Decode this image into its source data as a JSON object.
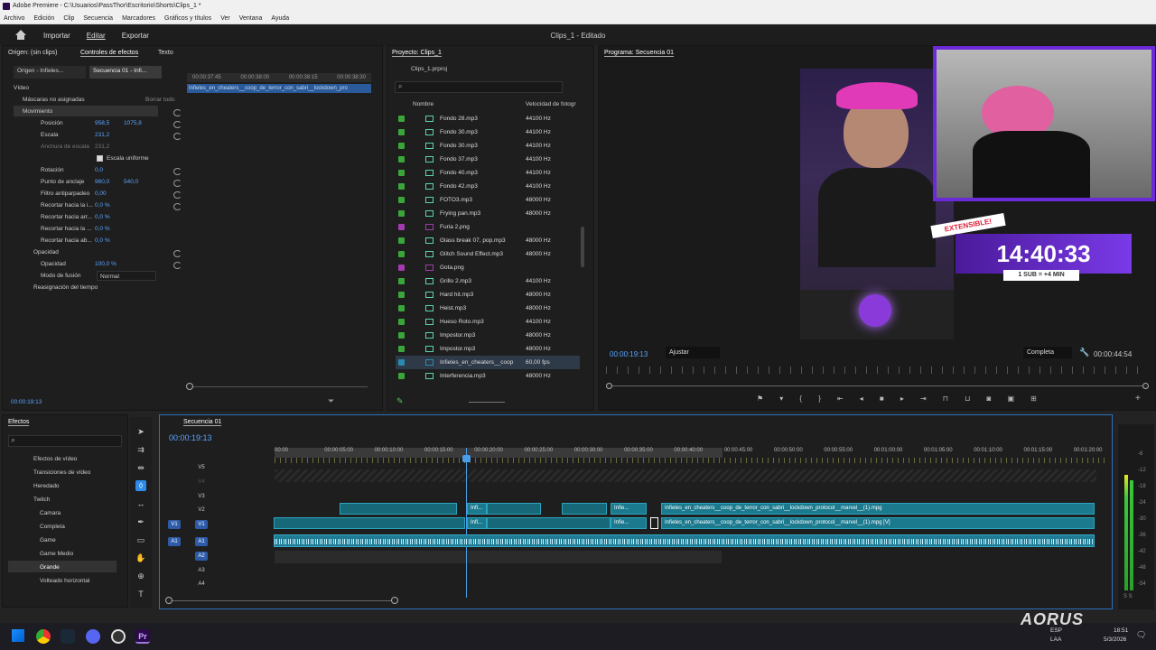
{
  "window": {
    "title": "Adobe Premiere - C:\\Usuarios\\PassThor\\Escritorio\\Shorts\\Clips_1 *"
  },
  "menu": [
    "Archivo",
    "Edición",
    "Clip",
    "Secuencia",
    "Marcadores",
    "Gráficos y títulos",
    "Ver",
    "Ventana",
    "Ayuda"
  ],
  "workspace": {
    "tabs": [
      "Importar",
      "Editar",
      "Exportar"
    ],
    "active": "Editar",
    "project_title": "Clips_1 - Editado"
  },
  "effect_controls": {
    "tabs": [
      "Origen: (sin clips)",
      "Controles de efectos",
      "Texto"
    ],
    "sub_tabs": [
      "Origen - Infieles...",
      "Secuencia 01 - Infi..."
    ],
    "ruler_times": [
      "00:00:37:45",
      "00:00:38:00",
      "00:00:38:15",
      "00:00:38:30"
    ],
    "clip_name": "Infieles_en_cheaters__coop_de_terror_con_sabri__lockdown_pro",
    "section_video": "Vídeo",
    "masks": "Máscaras no asignadas",
    "delete_all": "Borrar todo",
    "rows": [
      {
        "label": "Movimiento",
        "values": []
      },
      {
        "label": "Posición",
        "values": [
          "958,5",
          "1075,8"
        ]
      },
      {
        "label": "Escala",
        "values": [
          "231,2"
        ]
      },
      {
        "label": "Anchura de escala",
        "values": [
          "231,2"
        ]
      },
      {
        "label": "Escala uniforme",
        "values": []
      },
      {
        "label": "Rotación",
        "values": [
          "0,0"
        ]
      },
      {
        "label": "Punto de anclaje",
        "values": [
          "960,0",
          "540,0"
        ]
      },
      {
        "label": "Filtro antiparpadeo",
        "values": [
          "0,00"
        ]
      },
      {
        "label": "Recortar hacia la i...",
        "values": [
          "0,0 %"
        ]
      },
      {
        "label": "Recortar hacia arr...",
        "values": [
          "0,0 %"
        ]
      },
      {
        "label": "Recortar hacia la ...",
        "values": [
          "0,0 %"
        ]
      },
      {
        "label": "Recortar hacia ab...",
        "values": [
          "0,0 %"
        ]
      },
      {
        "label": "Opacidad",
        "values": []
      },
      {
        "label": "Opacidad",
        "values": [
          "100,0 %"
        ]
      },
      {
        "label": "Modo de fusión",
        "values": [
          "Normal"
        ]
      },
      {
        "label": "Reasignación del tiempo",
        "values": []
      }
    ],
    "timecode": "00:00:19:13"
  },
  "project": {
    "tab": "Proyecto: Clips_1",
    "file": "Clips_1.prproj",
    "col_name": "Nombre",
    "col_rate": "Velocidad de fotogr",
    "files": [
      {
        "name": "Fondo 28.mp3",
        "rate": "44100 Hz",
        "color": "#3aa63a",
        "type": "audio"
      },
      {
        "name": "Fondo 30.mp3",
        "rate": "44100 Hz",
        "color": "#3aa63a",
        "type": "audio"
      },
      {
        "name": "Fondo 30.mp3",
        "rate": "44100 Hz",
        "color": "#3aa63a",
        "type": "audio"
      },
      {
        "name": "Fondo 37.mp3",
        "rate": "44100 Hz",
        "color": "#3aa63a",
        "type": "audio"
      },
      {
        "name": "Fondo 40.mp3",
        "rate": "44100 Hz",
        "color": "#3aa63a",
        "type": "audio"
      },
      {
        "name": "Fondo 42.mp3",
        "rate": "44100 Hz",
        "color": "#3aa63a",
        "type": "audio"
      },
      {
        "name": "FOTO3.mp3",
        "rate": "48000 Hz",
        "color": "#3aa63a",
        "type": "audio"
      },
      {
        "name": "Frying pan.mp3",
        "rate": "48000 Hz",
        "color": "#3aa63a",
        "type": "audio"
      },
      {
        "name": "Furia 2.png",
        "rate": "",
        "color": "#a23ab0",
        "type": "image"
      },
      {
        "name": "Glass break 07, pop.mp3",
        "rate": "48000 Hz",
        "color": "#3aa63a",
        "type": "audio"
      },
      {
        "name": "Glitch Sound Effect.mp3",
        "rate": "48000 Hz",
        "color": "#3aa63a",
        "type": "audio"
      },
      {
        "name": "Gota.png",
        "rate": "",
        "color": "#a23ab0",
        "type": "image"
      },
      {
        "name": "Grillo 2.mp3",
        "rate": "44100 Hz",
        "color": "#3aa63a",
        "type": "audio"
      },
      {
        "name": "Hard hit.mp3",
        "rate": "48000 Hz",
        "color": "#3aa63a",
        "type": "audio"
      },
      {
        "name": "Heist.mp3",
        "rate": "48000 Hz",
        "color": "#3aa63a",
        "type": "audio"
      },
      {
        "name": "Hueso Roto.mp3",
        "rate": "44100 Hz",
        "color": "#3aa63a",
        "type": "audio"
      },
      {
        "name": "Impostor.mp3",
        "rate": "48000 Hz",
        "color": "#3aa63a",
        "type": "audio"
      },
      {
        "name": "Impostor.mp3",
        "rate": "48000 Hz",
        "color": "#3aa63a",
        "type": "audio"
      },
      {
        "name": "Infieles_en_cheaters__coop",
        "rate": "60,00 fps",
        "color": "#2a8ab0",
        "type": "video"
      },
      {
        "name": "Interferencia.mp3",
        "rate": "48000 Hz",
        "color": "#3aa63a",
        "type": "audio"
      }
    ]
  },
  "program": {
    "tab": "Programa: Secuencia 01",
    "timecode": "00:00:19:13",
    "fit": "Ajustar",
    "quality": "Completa",
    "duration": "00:00:44:54",
    "overlay": {
      "badge": "EXTENSIBLE!",
      "timer": "14:40:33",
      "sub": "1 SUB = +4 MIN"
    }
  },
  "effects": {
    "tab": "Efectos",
    "items": [
      "Efectos de vídeo",
      "Transiciones de vídeo",
      "Heredado",
      "Twitch",
      "Camara",
      "Completa",
      "Game",
      "Game Medio",
      "Grande",
      "Volteado horizontal"
    ]
  },
  "timeline": {
    "tab": "Secuencia 01",
    "timecode": "00:00:19:13",
    "ticks": [
      "00:00",
      "00:00:05:00",
      "00:00:10:00",
      "00:00:15:00",
      "00:00:20:00",
      "00:00:25:00",
      "00:00:30:00",
      "00:00:35:00",
      "00:00:40:00",
      "00:00:45:00",
      "00:00:50:00",
      "00:00:55:00",
      "00:01:00:00",
      "00:01:05:00",
      "00:01:10:00",
      "00:01:15:00",
      "00:01:20:00"
    ],
    "video_tracks": [
      "V5",
      "V4",
      "V3",
      "V2",
      "V1"
    ],
    "audio_tracks": [
      "A1",
      "A2",
      "A3",
      "A4"
    ],
    "clip_v2": "Infieles_en_cheaters__coop_de_terror_con_sabri__lockdown_protocol__marvel__(1).mpg",
    "clip_v1": "Infieles_en_cheaters__coop_de_terror_con_sabri__lockdown_protocol__marvel__(1).mpg [V]",
    "short_label": "Infie...",
    "short_label2": "Infl...",
    "meter_labels": [
      "-6",
      "-12",
      "-18",
      "-24",
      "-30",
      "-36",
      "-42",
      "-48",
      "-54"
    ],
    "meter_ss": "S S"
  },
  "taskbar": {
    "lang": "ESP",
    "region": "LAA",
    "time": "18:51",
    "date": "5/3/2026",
    "brand": "AORUS"
  },
  "colors": {
    "accent": "#2d8ceb",
    "clip": "#1c7a8f",
    "audio": "#1f7c94",
    "timer_bg": "#6a2ad8"
  }
}
